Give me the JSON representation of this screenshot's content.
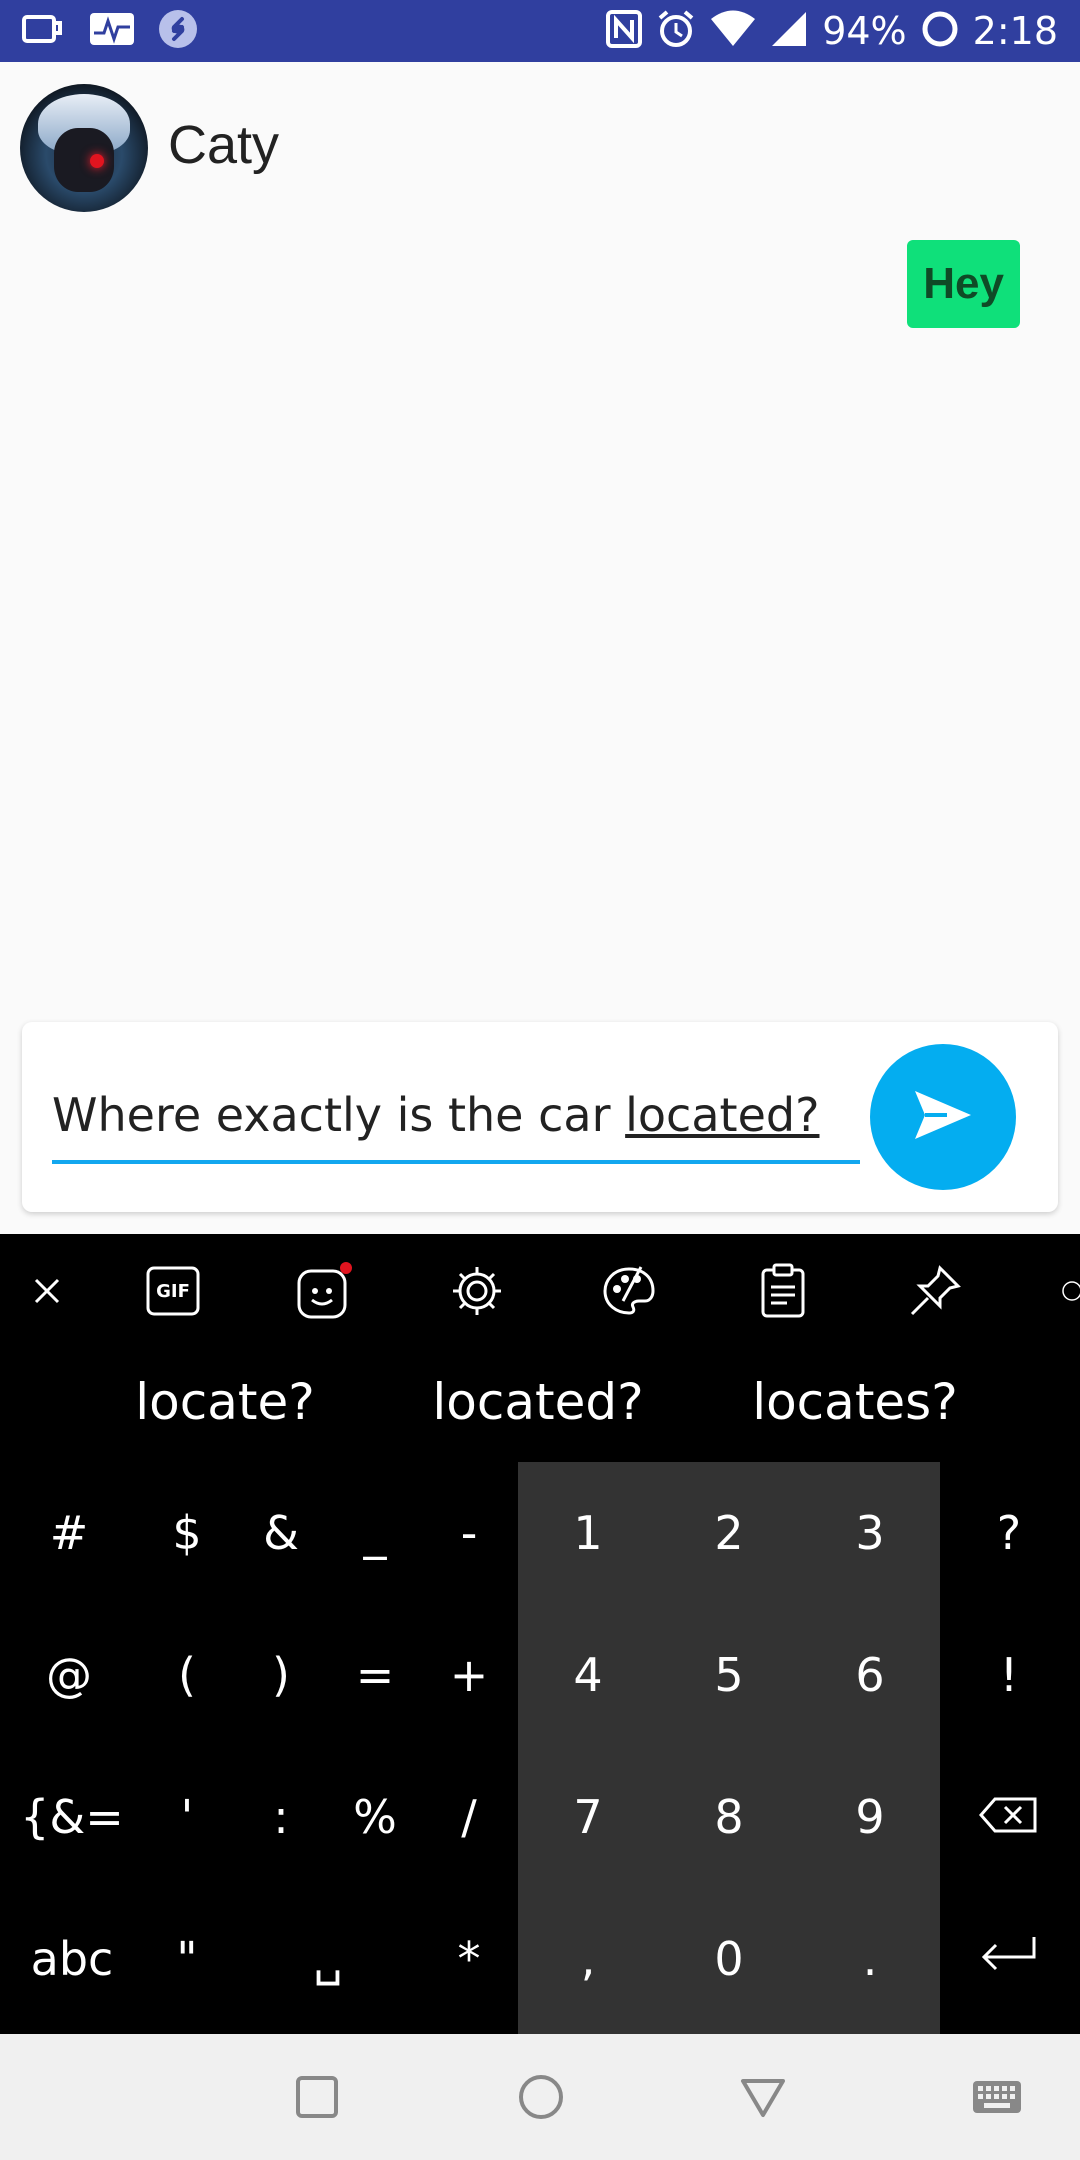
{
  "status_bar": {
    "battery": "94%",
    "time": "2:18",
    "bg_color": "#303f9f"
  },
  "contact": {
    "name": "Caty"
  },
  "messages": [
    {
      "text": "Hey",
      "side": "right",
      "color": "#0fe07a"
    }
  ],
  "composer": {
    "text_before": "Where exactly is the car ",
    "text_underlined": "located?",
    "accent": "#04adf0"
  },
  "suggestions": [
    "locate?",
    "located?",
    "locates?"
  ],
  "keyboard": {
    "toolbar_icons": [
      "close-icon",
      "gif-icon",
      "sticker-icon",
      "settings-icon",
      "theme-palette-icon",
      "clipboard-icon",
      "pin-icon"
    ],
    "gif_label": "GIF",
    "symbol_rows": [
      [
        "#",
        "$",
        "&",
        "_",
        "-"
      ],
      [
        "@",
        "(",
        ")",
        "=",
        "+"
      ],
      [
        "{&=",
        "'",
        ":",
        "%",
        "/"
      ],
      [
        "abc",
        "\"",
        "␣",
        "*"
      ]
    ],
    "num_rows": [
      [
        "1",
        "2",
        "3"
      ],
      [
        "4",
        "5",
        "6"
      ],
      [
        "7",
        "8",
        "9"
      ],
      [
        ",",
        "0",
        "."
      ]
    ],
    "right_col": [
      "?",
      "!",
      "backspace",
      "enter"
    ]
  }
}
